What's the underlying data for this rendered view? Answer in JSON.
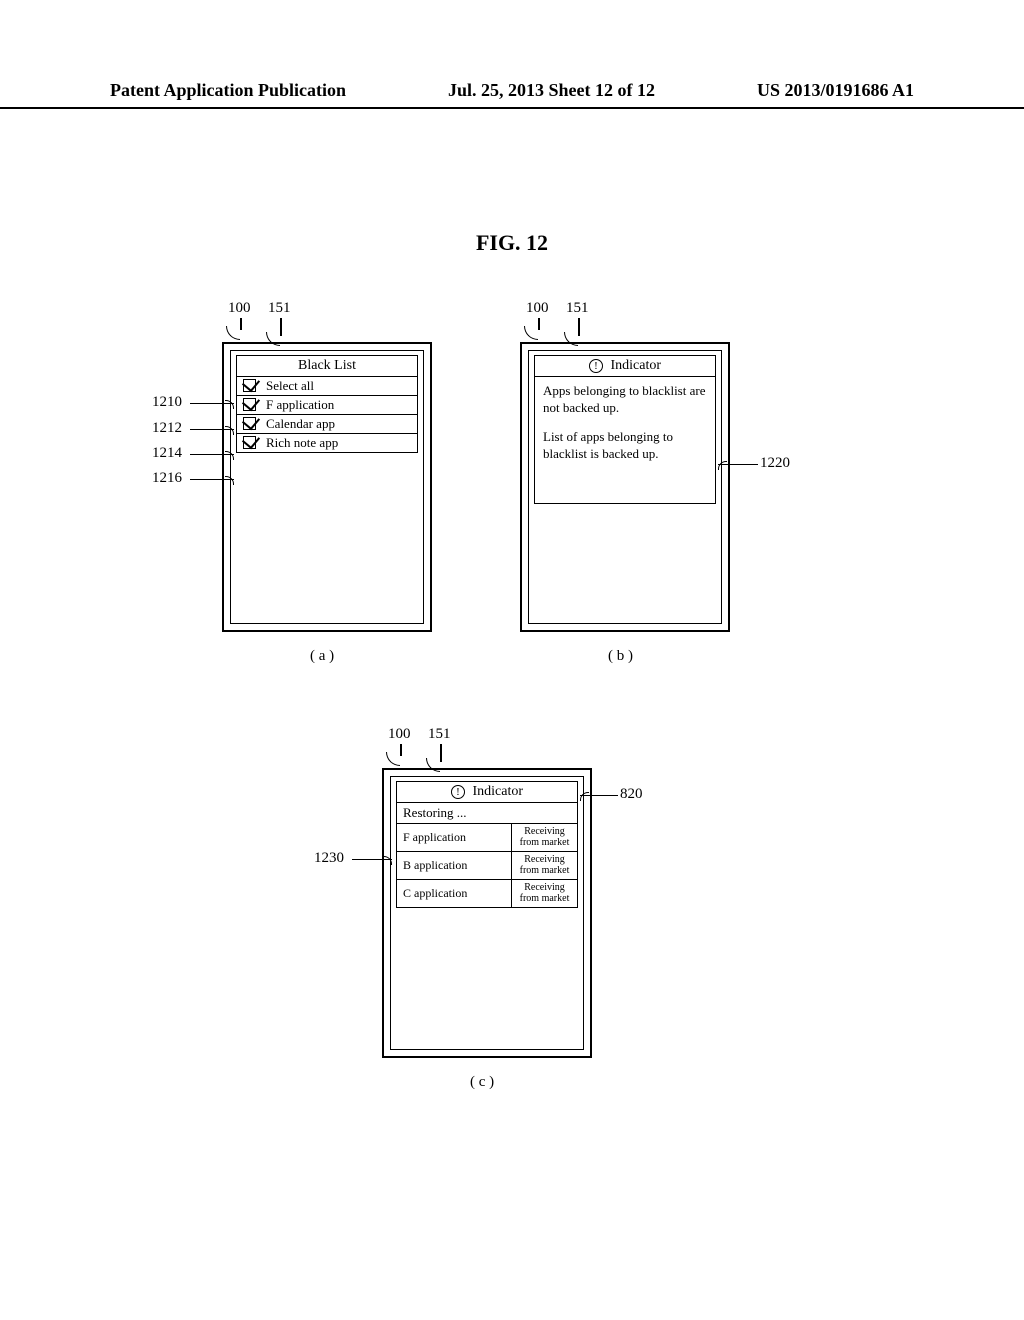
{
  "header": {
    "left": "Patent Application Publication",
    "mid": "Jul. 25, 2013  Sheet 12 of 12",
    "right": "US 2013/0191686 A1"
  },
  "figure_title": "FIG. 12",
  "ref_nums": {
    "phone": "100",
    "screen": "151",
    "row_select_all": "1210",
    "row_f_app": "1212",
    "row_cal": "1214",
    "row_rich": "1216",
    "msg_box": "1220",
    "rest_row": "1230",
    "indicator_c": "820"
  },
  "sub_labels": {
    "a": "( a )",
    "b": "( b )",
    "c": "( c )"
  },
  "panel_a": {
    "title": "Black List",
    "rows": {
      "r0": "Select all",
      "r1": "F application",
      "r2": "Calendar app",
      "r3": "Rich note app"
    }
  },
  "panel_b": {
    "indicator": "Indicator",
    "msg1": "Apps belonging to blacklist are not backed up.",
    "msg2": "List of apps belonging to blacklist is backed up."
  },
  "panel_c": {
    "indicator": "Indicator",
    "restoring": "Restoring ...",
    "status": "Receiving from market",
    "apps": {
      "a0": "F application",
      "a1": "B application",
      "a2": "C application"
    }
  }
}
